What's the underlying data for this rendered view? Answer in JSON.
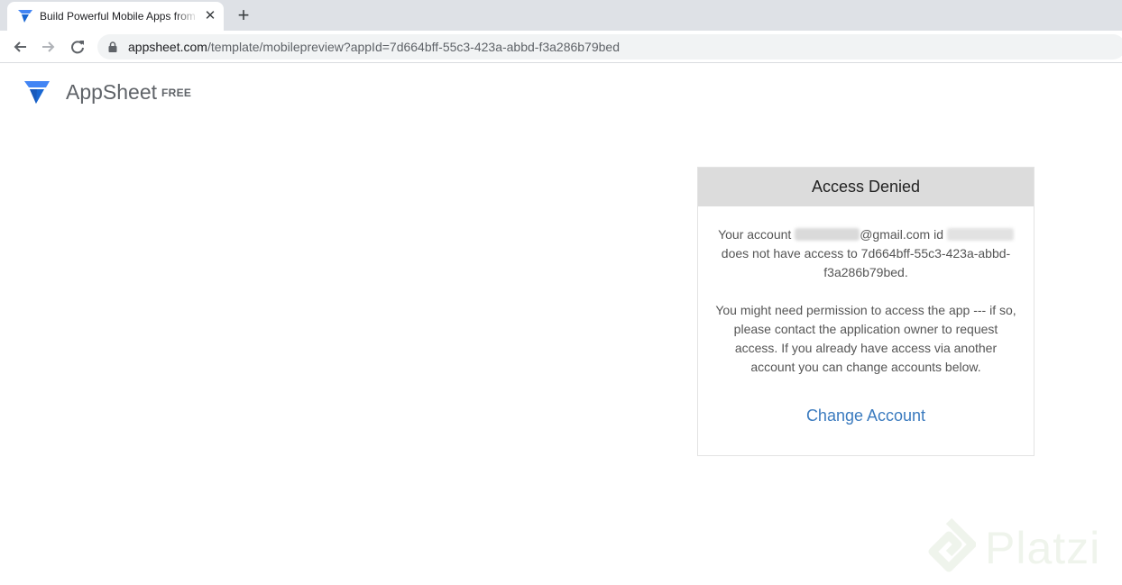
{
  "browser": {
    "tab_title": "Build Powerful Mobile Apps from Data",
    "tab_close": "✕",
    "new_tab": "+",
    "url_host": "appsheet.com",
    "url_path": "/template/mobilepreview?appId=7d664bff-55c3-423a-abbd-f3a286b79bed"
  },
  "header": {
    "app_name": "AppSheet",
    "plan": "FREE"
  },
  "card": {
    "title": "Access Denied",
    "account_prefix": "Your account",
    "email_domain": "@gmail.com",
    "id_label": "id",
    "no_access_text": "does not have access to 7d664bff-55c3-423a-abbd-f3a286b79bed.",
    "permission_text": "You might need permission to access the app --- if so, please contact the application owner to request access. If you already have access via another account you can change accounts below.",
    "change_account_label": "Change Account"
  },
  "watermark": {
    "brand": "Platzi"
  },
  "colors": {
    "link": "#3b7bbf",
    "card_header_bg": "#dcdcdc",
    "appsheet_blue": "#1a73e8"
  }
}
